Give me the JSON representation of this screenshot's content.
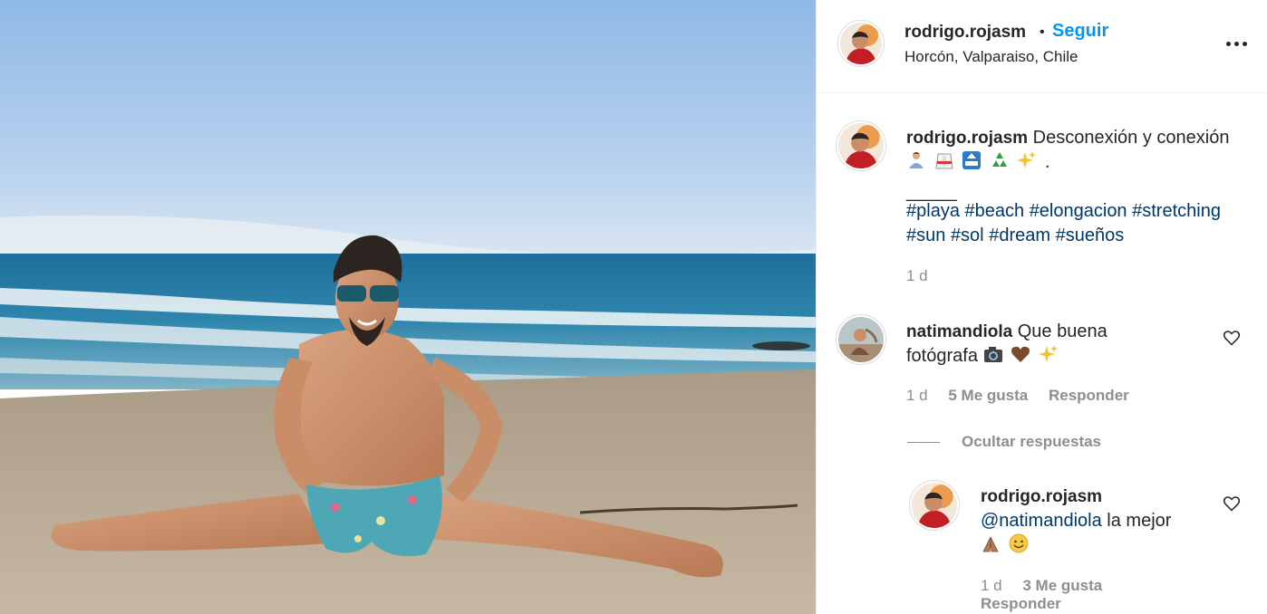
{
  "post": {
    "username": "rodrigo.rojasm",
    "follow_label": "Seguir",
    "separator": "•",
    "location": "Horcón, Valparaiso, Chile",
    "more_icon": "more-options-icon"
  },
  "caption": {
    "username": "rodrigo.rojasm",
    "text": "Desconexión y conexión",
    "emojis": [
      "man-meditating-emoji",
      "martial-arts-uniform-emoji",
      "top-arrow-emoji",
      "recycling-emoji",
      "sparkles-emoji"
    ],
    "trailing": ".",
    "divider": "_____",
    "hashtags_line1": [
      "#playa",
      "#beach",
      "#elongacion",
      "#stretching"
    ],
    "hashtags_line2": [
      "#sun",
      "#sol",
      "#dream",
      "#sueños"
    ],
    "time": "1 d"
  },
  "comments": [
    {
      "username": "natimandiola",
      "text_line1": "Que buena",
      "text_line2": "fotógrafa",
      "emojis": [
        "camera-emoji",
        "brown-heart-emoji",
        "sparkles-emoji"
      ],
      "time": "1 d",
      "likes": "5 Me gusta",
      "reply_label": "Responder",
      "hide_replies_label": "Ocultar respuestas"
    }
  ],
  "replies": [
    {
      "username": "rodrigo.rojasm",
      "mention": "@natimandiola",
      "text": "la mejor",
      "emojis": [
        "folded-hands-emoji",
        "smiling-face-emoji"
      ],
      "time": "1 d",
      "likes": "3 Me gusta",
      "reply_label": "Responder"
    }
  ],
  "colors": {
    "follow_blue": "#0095f6",
    "hashtag": "#00376b",
    "meta_gray": "#8e8e8e",
    "text": "#262626"
  }
}
